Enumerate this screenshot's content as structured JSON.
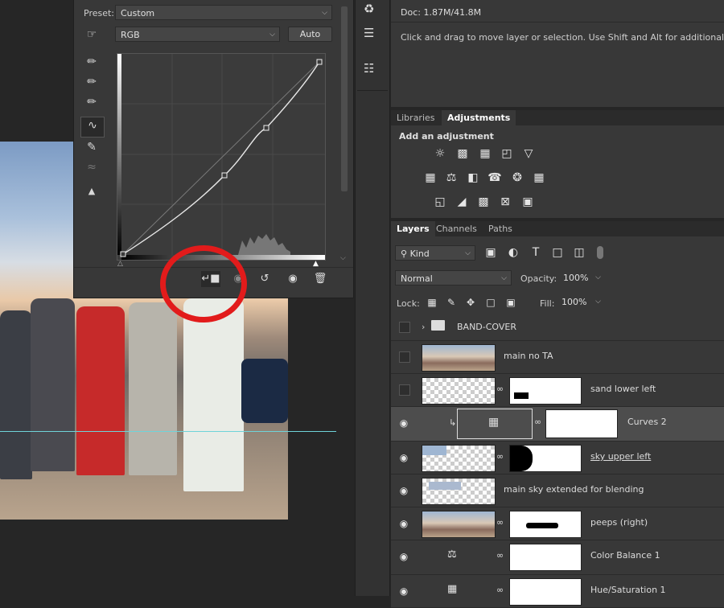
{
  "properties": {
    "preset_label": "Preset:",
    "preset_value": "Custom",
    "channel_value": "RGB",
    "auto_label": "Auto"
  },
  "info": {
    "doc": "Doc: 1.87M/41.8M",
    "hint": "Click and drag to move layer or selection.  Use Shift and Alt for additional options."
  },
  "adjustments": {
    "tabs": [
      "Libraries",
      "Adjustments"
    ],
    "heading": "Add an adjustment"
  },
  "layers_panel": {
    "tabs": [
      "Layers",
      "Channels",
      "Paths"
    ],
    "filter_kind": "Kind",
    "blend_mode": "Normal",
    "opacity_label": "Opacity:",
    "opacity_value": "100%",
    "lock_label": "Lock:",
    "fill_label": "Fill:",
    "fill_value": "100%",
    "layers": [
      {
        "name": "BAND-COVER",
        "type": "group",
        "visible": false
      },
      {
        "name": "main no TA",
        "type": "pixel",
        "visible": false
      },
      {
        "name": "sand lower left",
        "type": "masked",
        "visible": false
      },
      {
        "name": "Curves 2",
        "type": "adjustment",
        "visible": true,
        "selected": true
      },
      {
        "name": "sky upper left",
        "type": "masked",
        "visible": true
      },
      {
        "name": "main sky extended for blending",
        "type": "pixel",
        "visible": true
      },
      {
        "name": "peeps (right)",
        "type": "masked",
        "visible": true
      },
      {
        "name": "Color Balance 1",
        "type": "adjustment",
        "visible": true
      },
      {
        "name": "Hue/Saturation 1",
        "type": "adjustment",
        "visible": true
      }
    ]
  },
  "colors": {
    "panel_bg": "#383838",
    "guide": "#6fd3d9",
    "highlight_circle": "#e21b1b"
  }
}
